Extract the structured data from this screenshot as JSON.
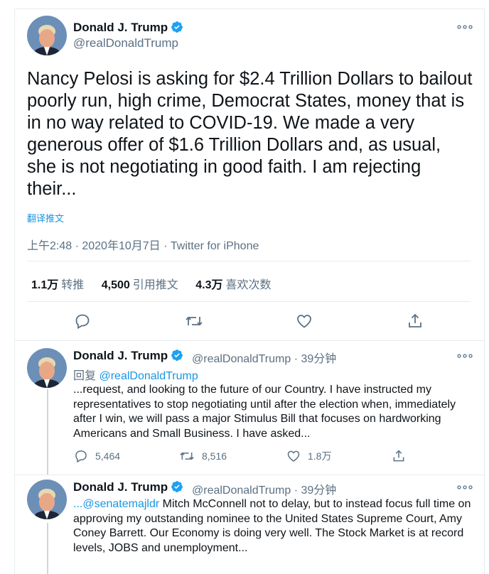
{
  "main_tweet": {
    "name": "Donald J. Trump",
    "handle": "@realDonaldTrump",
    "text": "Nancy Pelosi is asking for $2.4 Trillion Dollars to bailout poorly run, high crime, Democrat States, money that is in no way related to COVID-19. We made a very generous offer of $1.6 Trillion Dollars and, as usual, she is not negotiating in good faith. I am rejecting their...",
    "translate_label": "翻译推文",
    "timestamp": "上午2:48 · 2020年10月7日 · Twitter for iPhone",
    "retweets_count": "1.1万",
    "retweets_label": "转推",
    "quotes_count": "4,500",
    "quotes_label": "引用推文",
    "likes_count": "4.3万",
    "likes_label": "喜欢次数"
  },
  "replies": [
    {
      "name": "Donald J. Trump",
      "handle_time": "@realDonaldTrump · 39分钟",
      "reply_prefix": "回复",
      "reply_to": "@realDonaldTrump",
      "text": "...request, and looking to the future of our Country. I have instructed my representatives to stop negotiating until after the election when, immediately after I win, we will pass a major Stimulus Bill that focuses on hardworking Americans and Small Business. I have asked...",
      "reply_count": "5,464",
      "retweet_count": "8,516",
      "like_count": "1.8万"
    },
    {
      "name": "Donald J. Trump",
      "handle_time": "@realDonaldTrump · 39分钟",
      "mention": "...@senatemajldr",
      "text": " Mitch McConnell not to delay, but to instead focus full time on approving my outstanding nominee to the United States Supreme Court, Amy Coney Barrett. Our Economy is doing very well. The Stock Market is at record levels, JOBS and unemployment..."
    }
  ],
  "colors": {
    "accent": "#1b95e0",
    "verified": "#1da1f2",
    "secondary_text": "#5b7083",
    "divider": "#e6ecf0"
  },
  "icons": [
    "reply-icon",
    "retweet-icon",
    "like-icon",
    "share-icon",
    "more-icon",
    "verified-icon"
  ]
}
